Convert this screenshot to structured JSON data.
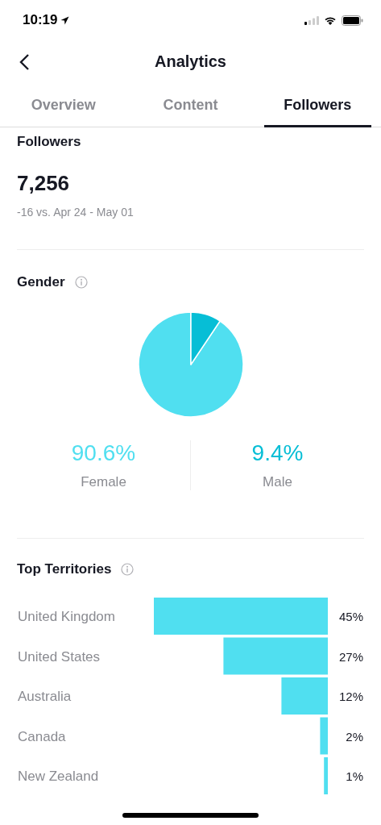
{
  "status_bar": {
    "time": "10:19"
  },
  "header": {
    "title": "Analytics"
  },
  "tabs": [
    {
      "label": "Overview",
      "selected": false
    },
    {
      "label": "Content",
      "selected": false
    },
    {
      "label": "Followers",
      "selected": true
    }
  ],
  "followers": {
    "heading": "Followers",
    "count": "7,256",
    "change": "-16 vs. Apr 24 - May 01"
  },
  "gender": {
    "heading": "Gender",
    "chart_data": {
      "type": "pie",
      "categories": [
        "Female",
        "Male"
      ],
      "values": [
        90.6,
        9.4
      ]
    },
    "stats": [
      {
        "value": "90.6%",
        "color": "#50dff0"
      },
      {
        "value": "9.4%",
        "color": "#06bed6"
      }
    ]
  },
  "territories": {
    "heading": "Top Territories",
    "chart_data": {
      "type": "bar",
      "orientation": "horizontal",
      "categories": [
        "United Kingdom",
        "United States",
        "Australia",
        "Canada",
        "New Zealand"
      ],
      "values": [
        45,
        27,
        12,
        2,
        1
      ],
      "value_labels": [
        "45%",
        "27%",
        "12%",
        "2%",
        "1%"
      ]
    }
  }
}
